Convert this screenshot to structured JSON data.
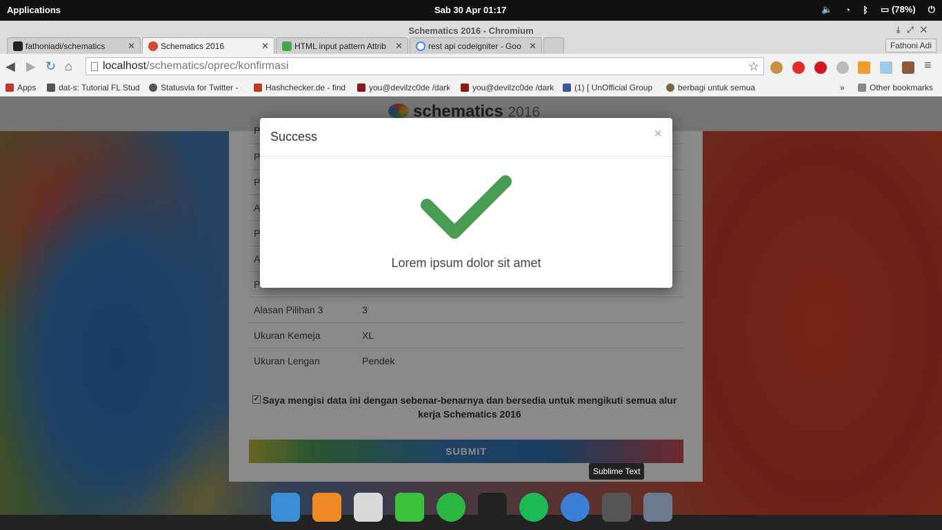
{
  "panel": {
    "apps_label": "Applications",
    "clock": "Sab 30 Apr   01:17",
    "battery": "(78%)"
  },
  "window": {
    "title": "Schematics 2016 - Chromium"
  },
  "tabs": [
    {
      "label": "fathoniadi/schematics",
      "color": "#222222"
    },
    {
      "label": "Schematics 2016",
      "color": "#d14b3a"
    },
    {
      "label": "HTML input pattern Attrib",
      "color": "#4aa64a"
    },
    {
      "label": "rest api codeigniter - Goo",
      "color": "#4285f4"
    }
  ],
  "profile": "Fathoni Adi",
  "address": {
    "host": "localhost",
    "path": "/schematics/oprec/konfirmasi"
  },
  "bookmarks": [
    {
      "label": "Apps",
      "color": "#c0392b"
    },
    {
      "label": "dat-s: Tutorial FL Stud",
      "color": "#555555"
    },
    {
      "label": "Statusvia for Twitter -",
      "color": "#555555"
    },
    {
      "label": "Hashchecker.de - find",
      "color": "#c0392b"
    },
    {
      "label": "you@devilzc0de /dark",
      "color": "#8b1a1a"
    },
    {
      "label": "you@devilzc0de /dark",
      "color": "#8b1a1a"
    },
    {
      "label": "(1) [ UnOfficial Group",
      "color": "#3b5998"
    },
    {
      "label": "berbagi untuk semua",
      "color": "#7a6a3a"
    }
  ],
  "other_bookmarks": "Other bookmarks",
  "site": {
    "logo": "schematics",
    "year": "2016"
  },
  "rows": [
    {
      "key": "Alasan Pilihan 3",
      "value": "3"
    },
    {
      "key": "Ukuran Kemeja",
      "value": "XL"
    },
    {
      "key": "Ukuran Lengan",
      "value": "Pendek"
    }
  ],
  "row_partial_letters": [
    "P",
    "P",
    "A",
    "P",
    "A",
    "P"
  ],
  "agreement": "Saya mengisi data ini dengan sebenar-benarnya dan bersedia untuk mengikuti semua alur kerja Schematics 2016",
  "submit_label": "SUBMIT",
  "modal": {
    "title": "Success",
    "close": "×",
    "message": "Lorem ipsum dolor sit amet",
    "check_color": "#4a9b54"
  },
  "dock": {
    "tooltip": "Sublime Text",
    "icons": [
      {
        "name": "workspace-icon",
        "color": "#3a8ed6"
      },
      {
        "name": "music-icon",
        "color": "#f08a24"
      },
      {
        "name": "home-folder-icon",
        "color": "#d8d8d8"
      },
      {
        "name": "line-icon",
        "color": "#3cc13c"
      },
      {
        "name": "whatsapp-icon",
        "color": "#2bb741"
      },
      {
        "name": "terminal-icon",
        "color": "#222222"
      },
      {
        "name": "spotify-icon",
        "color": "#1db954"
      },
      {
        "name": "chromium-icon",
        "color": "#3b80d6"
      },
      {
        "name": "sublime-text-icon",
        "color": "#555555"
      },
      {
        "name": "settings-icon",
        "color": "#6b7a8f"
      }
    ]
  }
}
